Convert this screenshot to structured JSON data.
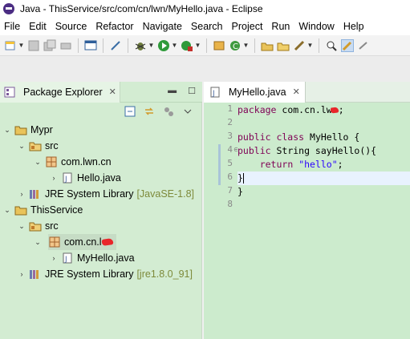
{
  "window": {
    "title": "Java - ThisService/src/com/cn/lwn/MyHello.java - Eclipse",
    "app_icon": "eclipse-icon"
  },
  "menubar": {
    "items": [
      "File",
      "Edit",
      "Source",
      "Refactor",
      "Navigate",
      "Search",
      "Project",
      "Run",
      "Window",
      "Help"
    ]
  },
  "package_explorer": {
    "tab_label": "Package Explorer",
    "tree": [
      {
        "label": "Mypr",
        "icon": "project-icon",
        "expanded": true
      },
      {
        "label": "src",
        "icon": "source-folder-icon",
        "expanded": true
      },
      {
        "label": "com.lwn.cn",
        "icon": "package-icon",
        "expanded": true
      },
      {
        "label": "Hello.java",
        "icon": "java-file-icon"
      },
      {
        "label": "JRE System Library",
        "suffix": "[JavaSE-1.8]",
        "icon": "library-icon"
      },
      {
        "label": "ThisService",
        "icon": "project-icon",
        "expanded": true
      },
      {
        "label": "src",
        "icon": "source-folder-icon",
        "expanded": true
      },
      {
        "label": "com.cn.l",
        "icon": "package-icon",
        "expanded": true,
        "selected": true
      },
      {
        "label": "MyHello.java",
        "icon": "java-file-icon"
      },
      {
        "label": "JRE System Library",
        "suffix": "[jre1.8.0_91]",
        "icon": "library-icon"
      }
    ]
  },
  "editor": {
    "tab_label": "MyHello.java",
    "line_numbers": [
      "1",
      "2",
      "3",
      "4",
      "5",
      "6",
      "7",
      "8"
    ],
    "lines": [
      {
        "kw": "package",
        "text": " com.cn.lw",
        "tail": ";"
      },
      {
        "text": ""
      },
      {
        "kw": "public class",
        "text": " MyHello {"
      },
      {
        "kw": "public",
        "text": " String sayHello(){"
      },
      {
        "pre": "    ",
        "kw": "return",
        "text": " ",
        "str": "\"hello\"",
        "tail": ";"
      },
      {
        "text": "}"
      },
      {
        "text": "}"
      },
      {
        "text": ""
      }
    ],
    "current_line": 6
  },
  "colors": {
    "view_background": "#d3ecd2",
    "editor_background": "#ccebcd",
    "keyword": "#7f0055",
    "string": "#2a00ff"
  }
}
